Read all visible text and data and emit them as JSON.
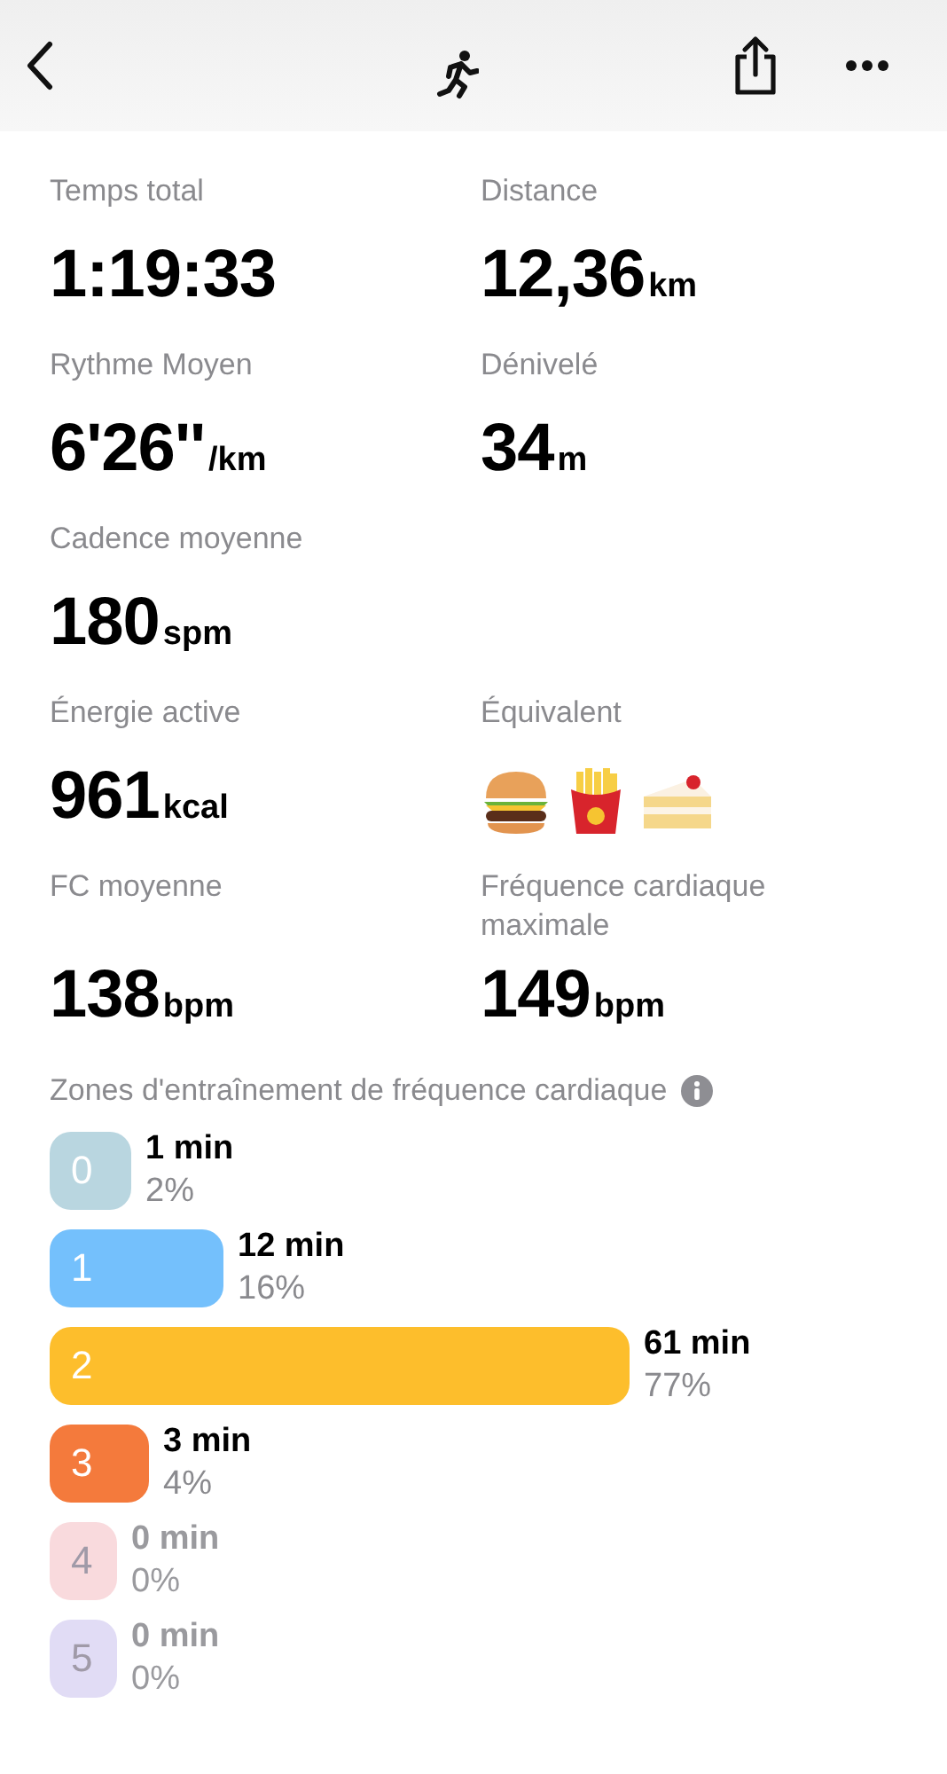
{
  "metrics": [
    {
      "kind": "value",
      "label": "Temps total",
      "value": "1:19:33"
    },
    {
      "kind": "value",
      "label": "Distance",
      "value": "12,36",
      "unit": "km"
    },
    {
      "kind": "value",
      "label": "Rythme Moyen",
      "value": "6'26''",
      "unit": "/km"
    },
    {
      "kind": "value",
      "label": "Dénivelé",
      "value": "34",
      "unit": "m"
    },
    {
      "kind": "value",
      "label": "Cadence moyenne",
      "value": "180",
      "unit": "spm"
    },
    {
      "kind": "empty"
    },
    {
      "kind": "value",
      "label": "Énergie active",
      "value": "961",
      "unit": "kcal"
    },
    {
      "kind": "foods",
      "label": "Équivalent"
    },
    {
      "kind": "value",
      "label": "FC moyenne",
      "value": "138",
      "unit": "bpm"
    },
    {
      "kind": "value",
      "label": "Fréquence cardiaque maximale",
      "value": "149",
      "unit": "bpm"
    }
  ],
  "zones_title": "Zones d'entraînement de fréquence cardiaque",
  "zones": [
    {
      "label": "0",
      "duration": "1 min",
      "percent": "2%",
      "color": "#b9d6e0",
      "disabled": false
    },
    {
      "label": "1",
      "duration": "12 min",
      "percent": "16%",
      "color": "#74c0fc",
      "disabled": false
    },
    {
      "label": "2",
      "duration": "61 min",
      "percent": "77%",
      "color": "#fdbe2c",
      "disabled": false
    },
    {
      "label": "3",
      "duration": "3 min",
      "percent": "4%",
      "color": "#f47a3c",
      "disabled": false
    },
    {
      "label": "4",
      "duration": "0 min",
      "percent": "0%",
      "color": "#f9dadd",
      "disabled": true
    },
    {
      "label": "5",
      "duration": "0 min",
      "percent": "0%",
      "color": "#e1dcf5",
      "disabled": true
    }
  ]
}
